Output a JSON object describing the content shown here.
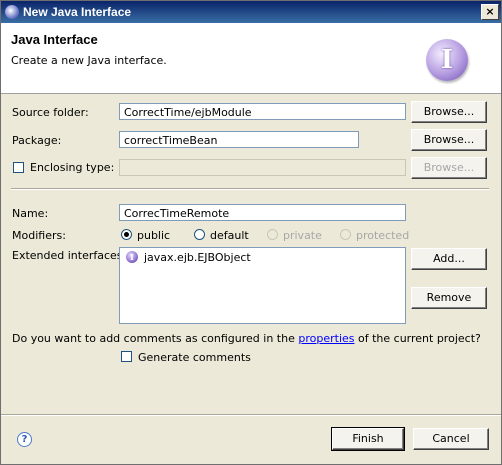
{
  "window": {
    "title": "New Java Interface",
    "close_glyph": "×"
  },
  "banner": {
    "title": "Java Interface",
    "message": "Create a new Java interface.",
    "icon": "java-interface-icon",
    "icon_glyph": "I"
  },
  "form": {
    "source_folder": {
      "label": "Source folder:",
      "value": "CorrectTime/ejbModule",
      "browse": "Browse..."
    },
    "package": {
      "label": "Package:",
      "value": "correctTimeBean",
      "browse": "Browse..."
    },
    "enclosing_type": {
      "label": "Enclosing type:",
      "value": "",
      "checked": false,
      "browse": "Browse..."
    },
    "name": {
      "label": "Name:",
      "value": "CorrecTimeRemote"
    },
    "modifiers": {
      "label": "Modifiers:",
      "options": [
        "public",
        "default",
        "private",
        "protected"
      ],
      "selected": "public"
    },
    "extended_interfaces": {
      "label": "Extended interfaces:",
      "items": [
        "javax.ejb.EJBObject"
      ],
      "add": "Add...",
      "remove": "Remove"
    },
    "comments": {
      "question_prefix": "Do you want to add comments as configured in the",
      "link": "properties",
      "question_suffix": "of the current project?",
      "checkbox_label": "Generate comments",
      "checked": false
    }
  },
  "footer": {
    "help_glyph": "?",
    "finish": "Finish",
    "cancel": "Cancel"
  }
}
